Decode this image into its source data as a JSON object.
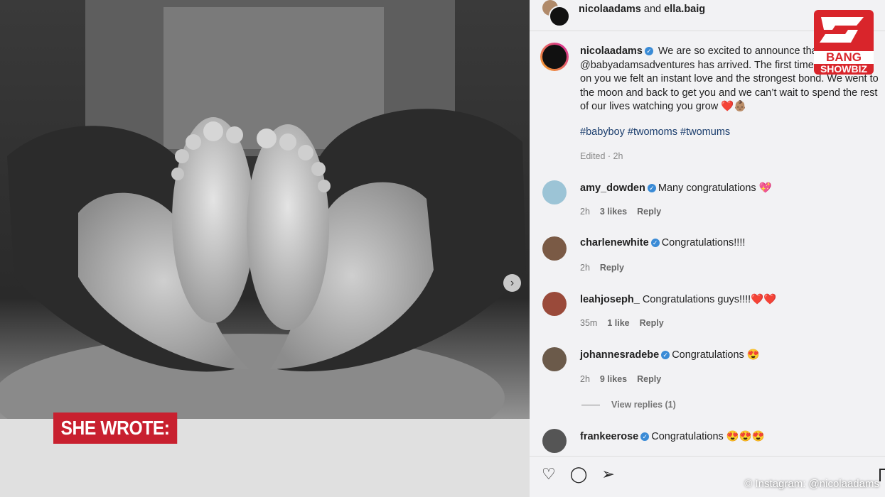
{
  "post": {
    "header_user1": "nicolaadams",
    "header_and": "and",
    "header_user2": "ella.baig",
    "author": "nicolaadams",
    "caption": "We are so excited to announce that @babyadamsadventures has arrived. The first time we laid eyes on you we felt an instant love and the strongest bond. We went to the moon and back to get you and we can’t wait to spend the rest of our lives watching you grow ❤️👶🏽",
    "hashtags": "#babyboy #twomoms #twomums",
    "edited": "Edited · 2h"
  },
  "comments": [
    {
      "user": "amy_dowden",
      "verified": true,
      "text": "Many congratulations 💖",
      "time": "2h",
      "likes": "3 likes",
      "reply": "Reply",
      "avatar_color": "#9cc4d6"
    },
    {
      "user": "charlenewhite",
      "verified": true,
      "text": "Congratulations!!!!",
      "time": "2h",
      "likes": "",
      "reply": "Reply",
      "avatar_color": "#7a5a45"
    },
    {
      "user": "leahjoseph_",
      "verified": false,
      "text": "Congratulations guys!!!!❤️❤️",
      "time": "35m",
      "likes": "1 like",
      "reply": "Reply",
      "avatar_color": "#9a4a3a"
    },
    {
      "user": "johannesradebe",
      "verified": true,
      "text": "Congratulations 😍",
      "time": "2h",
      "likes": "9 likes",
      "reply": "Reply",
      "avatar_color": "#6b5a4a"
    },
    {
      "user": "frankeerose",
      "verified": true,
      "text": "Congratulations 😍😍😍",
      "time": "",
      "likes": "",
      "reply": "",
      "avatar_color": "#555"
    }
  ],
  "view_replies": "View replies (1)",
  "overlay": {
    "lower_third": "SHE WROTE:",
    "credit": "© Instagram: @nicolaadams",
    "logo_top": "BANG",
    "logo_bottom": "SHOWBIZ"
  },
  "icons": {
    "like": "heart-icon",
    "comment": "comment-icon",
    "share": "send-icon",
    "next": "chevron-right-icon"
  }
}
